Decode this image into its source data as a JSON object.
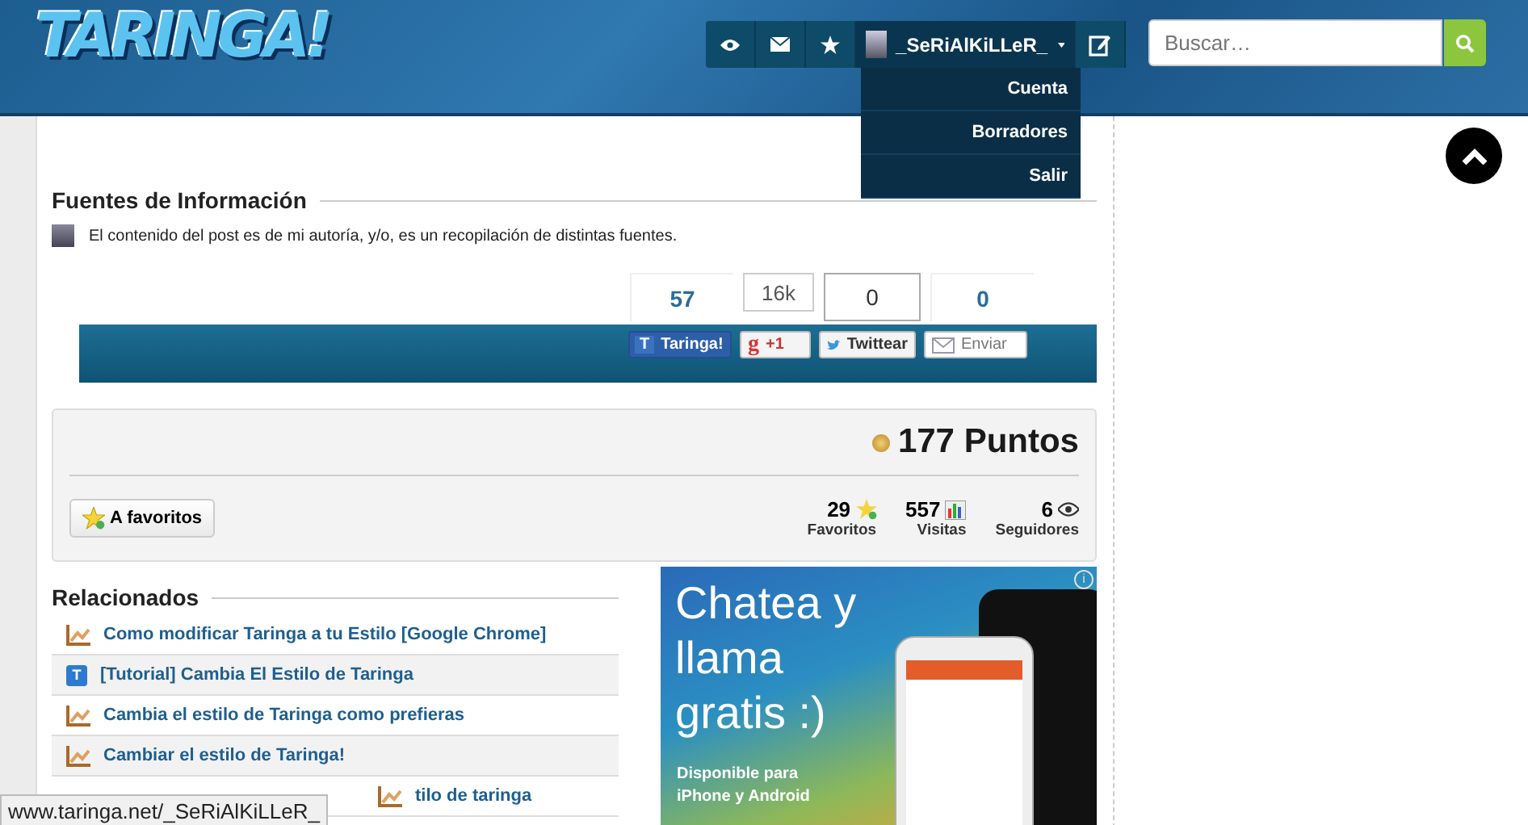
{
  "header": {
    "logo": "TARINGA!",
    "user": {
      "name": "_SeRiAlKiLLeR_"
    },
    "user_menu": [
      "Cuenta",
      "Borradores",
      "Salir"
    ],
    "search": {
      "placeholder": "Buscar…"
    }
  },
  "sources": {
    "title": "Fuentes de Información",
    "text": "El contenido del post es de mi autoría, y/o, es un recopilación de distintas fuentes."
  },
  "share": [
    {
      "kind": "taringa",
      "icon": "T",
      "count": "57",
      "label": "Taringa!"
    },
    {
      "kind": "gplus",
      "icon": "g",
      "count": "16k",
      "label": "+1"
    },
    {
      "kind": "twitter",
      "count": "0",
      "label": "Twittear"
    },
    {
      "kind": "email",
      "count": "0",
      "label": "Enviar"
    }
  ],
  "points": {
    "total": "177 Puntos",
    "favorite_button": "A favoritos",
    "stats": [
      {
        "kind": "favorites",
        "value": "29",
        "label": "Favoritos"
      },
      {
        "kind": "visits",
        "value": "557",
        "label": "Visitas"
      },
      {
        "kind": "followers",
        "value": "6",
        "label": "Seguidores"
      }
    ]
  },
  "related": {
    "title": "Relacionados",
    "items": [
      {
        "kind": "chart",
        "title": "Como modificar Taringa a tu Estilo [Google Chrome]"
      },
      {
        "kind": "taringa",
        "icon": "T",
        "title": "[Tutorial] Cambia El Estilo de Taringa"
      },
      {
        "kind": "chart",
        "title": "Cambia el estilo de Taringa como prefieras"
      },
      {
        "kind": "chart",
        "title": "Cambiar el estilo de Taringa!"
      },
      {
        "kind": "chart",
        "title": "tilo de taringa"
      }
    ]
  },
  "ad": {
    "info_icon": "i",
    "headline": "Chatea y llama gratis :)",
    "footer": "Disponible para iPhone y Android"
  },
  "status_bar": "www.taringa.net/_SeRiAlKiLLeR_"
}
